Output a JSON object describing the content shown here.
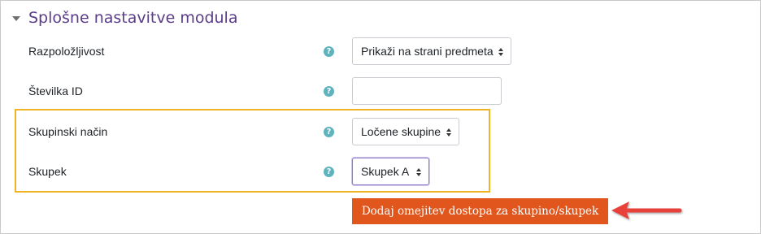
{
  "section": {
    "title": "Splošne nastavitve modula",
    "collapse_icon": "chevron-down-icon"
  },
  "fields": {
    "availability": {
      "label": "Razpoložljivost",
      "value": "Prikaži na strani predmeta"
    },
    "id_number": {
      "label": "Številka ID",
      "value": ""
    },
    "group_mode": {
      "label": "Skupinski način",
      "value": "Ločene skupine"
    },
    "grouping": {
      "label": "Skupek",
      "value": "Skupek A"
    }
  },
  "help_icon": {
    "glyph": "?",
    "name": "help-icon",
    "color": "#5fb3bf"
  },
  "action_button": {
    "label": "Dodaj omejitev dostopa za skupino/skupek",
    "color": "#e1561c"
  },
  "colors": {
    "title": "#5b3c88",
    "highlight": "#f0b323",
    "arrow": "#e8413b"
  }
}
